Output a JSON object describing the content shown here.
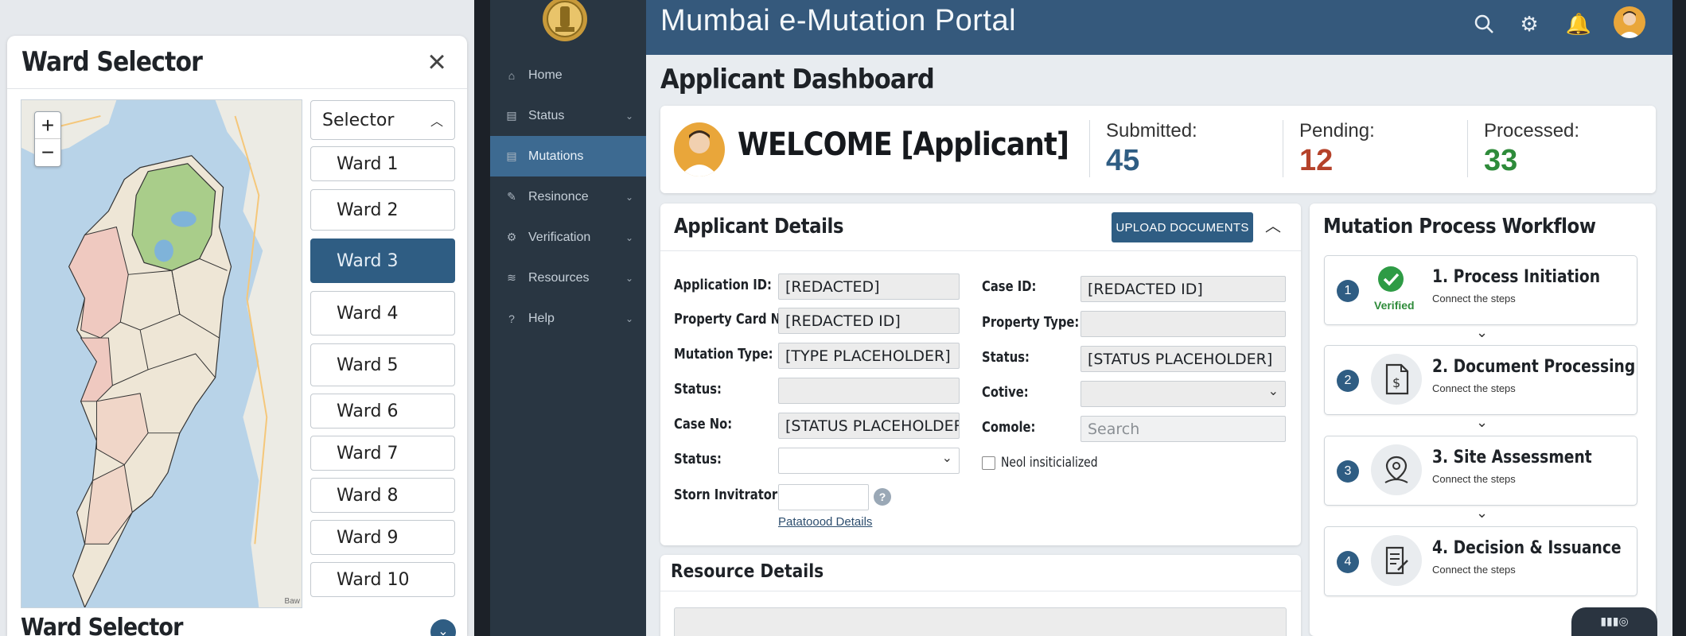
{
  "ward_panel": {
    "title": "Ward Selector",
    "footer_title": "Ward Selector",
    "selector_label": "Selector",
    "wards": [
      "Ward 1",
      "Ward 2",
      "Ward 3",
      "Ward 4",
      "Ward 5",
      "Ward 6",
      "Ward 7",
      "Ward 8",
      "Ward 9",
      "Ward 10"
    ],
    "active_ward": "Ward 3",
    "map_attribution": "Baw"
  },
  "app": {
    "title": "Mumbai e-Mutation Portal"
  },
  "sidebar": {
    "items": [
      {
        "label": "Home",
        "icon": "home-icon",
        "active": false,
        "chevron": false
      },
      {
        "label": "Status",
        "icon": "document-icon",
        "active": false,
        "chevron": true
      },
      {
        "label": "Mutations",
        "icon": "document-icon",
        "active": true,
        "chevron": false
      },
      {
        "label": "Resinonce",
        "icon": "edit-icon",
        "active": false,
        "chevron": true
      },
      {
        "label": "Verification",
        "icon": "gear-icon",
        "active": false,
        "chevron": true
      },
      {
        "label": "Resources",
        "icon": "layers-icon",
        "active": false,
        "chevron": true
      },
      {
        "label": "Help",
        "icon": "help-icon",
        "active": false,
        "chevron": true
      }
    ]
  },
  "dashboard": {
    "title": "Applicant Dashboard",
    "welcome": "WELCOME [Applicant]",
    "stats": [
      {
        "label": "Submitted:",
        "value": "45",
        "color": "#2f5d83"
      },
      {
        "label": "Pending:",
        "value": "12",
        "color": "#b5422a"
      },
      {
        "label": "Processed:",
        "value": "33",
        "color": "#2e8b3a"
      }
    ]
  },
  "details": {
    "title": "Applicant Details",
    "upload_label": "UPLOAD DOCUMENTS",
    "fields_left": [
      {
        "label": "Application ID:",
        "value": "[REDACTED]"
      },
      {
        "label": "Property Card No:",
        "value": "[REDACTED ID]"
      },
      {
        "label": "Mutation Type:",
        "value": "[TYPE PLACEHOLDER]"
      },
      {
        "label": "Status:",
        "value": ""
      },
      {
        "label": "Case No:",
        "value": "[STATUS PLACEHOLDER]"
      },
      {
        "label": "Status:",
        "value": ""
      },
      {
        "label": "Storn Invitrator:",
        "value": ""
      }
    ],
    "fields_right": [
      {
        "label": "Case ID:",
        "value": "[REDACTED ID]"
      },
      {
        "label": "Property Type:",
        "value": ""
      },
      {
        "label": "Status:",
        "value": "[STATUS PLACEHOLDER]"
      },
      {
        "label": "Cotive:",
        "value": ""
      },
      {
        "label": "Comole:",
        "value": ""
      }
    ],
    "search_placeholder": "Search",
    "checkbox_label": "Neol insiticialized",
    "link_label": "Patatoood Details"
  },
  "resources": {
    "title": "Resource Details"
  },
  "workflow": {
    "title": "Mutation Process Workflow",
    "verified_label": "Verified",
    "steps": [
      {
        "num": "1",
        "title": "1. Process Initiation",
        "sub": "Connect the steps",
        "icon": "check-icon"
      },
      {
        "num": "2",
        "title": "2. Document Processing",
        "sub": "Connect the steps",
        "icon": "document-dollar-icon"
      },
      {
        "num": "3",
        "title": "3. Site Assessment",
        "sub": "Connect the steps",
        "icon": "location-pin-icon"
      },
      {
        "num": "4",
        "title": "4. Decision & Issuance",
        "sub": "Connect the steps",
        "icon": "checklist-icon"
      }
    ]
  }
}
